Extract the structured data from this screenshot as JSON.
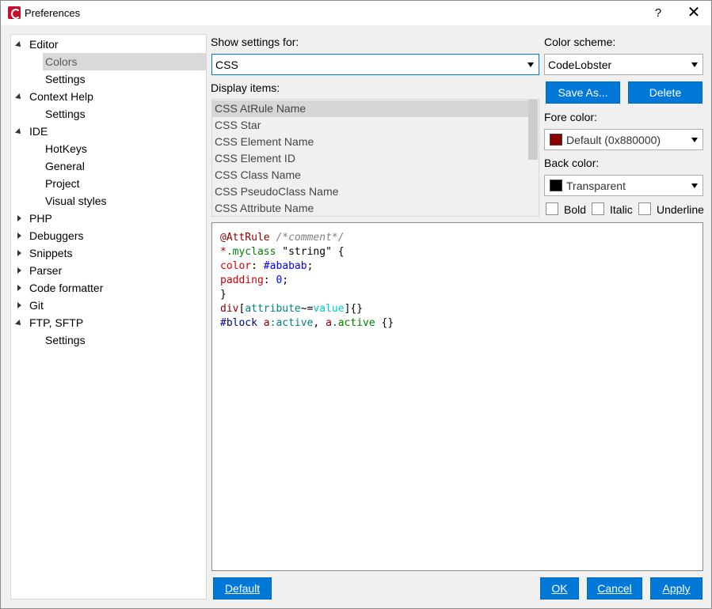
{
  "window": {
    "title": "Preferences",
    "help_label": "?",
    "close_label": "✕"
  },
  "tree": [
    {
      "label": "Editor",
      "level": 0,
      "expanded": true
    },
    {
      "label": "Colors",
      "level": 1,
      "selected": true
    },
    {
      "label": "Settings",
      "level": 1
    },
    {
      "label": "Context Help",
      "level": 0,
      "expanded": true
    },
    {
      "label": "Settings",
      "level": 1
    },
    {
      "label": "IDE",
      "level": 0,
      "expanded": true
    },
    {
      "label": "HotKeys",
      "level": 1
    },
    {
      "label": "General",
      "level": 1
    },
    {
      "label": "Project",
      "level": 1
    },
    {
      "label": "Visual styles",
      "level": 1
    },
    {
      "label": "PHP",
      "level": 0,
      "expanded": false
    },
    {
      "label": "Debuggers",
      "level": 0,
      "expanded": false
    },
    {
      "label": "Snippets",
      "level": 0,
      "expanded": false
    },
    {
      "label": "Parser",
      "level": 0,
      "expanded": false
    },
    {
      "label": "Code formatter",
      "level": 0,
      "expanded": false
    },
    {
      "label": "Git",
      "level": 0,
      "expanded": false
    },
    {
      "label": "FTP, SFTP",
      "level": 0,
      "expanded": true
    },
    {
      "label": "Settings",
      "level": 1
    }
  ],
  "settings_for": {
    "label": "Show settings for:",
    "value": "CSS"
  },
  "display_items": {
    "label": "Display items:",
    "items": [
      "CSS AtRule Name",
      "CSS Star",
      "CSS Element Name",
      "CSS Element ID",
      "CSS Class Name",
      "CSS PseudoClass Name",
      "CSS Attribute Name"
    ],
    "selected_index": 0
  },
  "color_scheme": {
    "label": "Color scheme:",
    "value": "CodeLobster",
    "save_as_label": "Save As...",
    "delete_label": "Delete"
  },
  "fore_color": {
    "label": "Fore color:",
    "value": "Default (0x880000)",
    "swatch": "#880000"
  },
  "back_color": {
    "label": "Back color:",
    "value": "Transparent",
    "swatch": "#000000"
  },
  "styles": {
    "bold": "Bold",
    "italic": "Italic",
    "underline": "Underline"
  },
  "preview": {
    "lines": [
      [
        {
          "t": "@AttRule",
          "c": "red"
        },
        {
          "t": " ",
          "c": "black"
        },
        {
          "t": "/*comment*/",
          "c": "gray"
        }
      ],
      [
        {
          "t": "*",
          "c": "red"
        },
        {
          "t": ".myclass",
          "c": "green"
        },
        {
          "t": " \"string\" {",
          "c": "black"
        }
      ],
      [
        {
          "t": "color",
          "c": "propred"
        },
        {
          "t": ": ",
          "c": "black"
        },
        {
          "t": "#ababab",
          "c": "blue"
        },
        {
          "t": ";",
          "c": "black"
        }
      ],
      [
        {
          "t": "padding",
          "c": "propred"
        },
        {
          "t": ": ",
          "c": "black"
        },
        {
          "t": "0",
          "c": "blue"
        },
        {
          "t": ";",
          "c": "black"
        }
      ],
      [
        {
          "t": "}",
          "c": "black"
        }
      ],
      [
        {
          "t": "div",
          "c": "red"
        },
        {
          "t": "[",
          "c": "black"
        },
        {
          "t": "attribute",
          "c": "teal"
        },
        {
          "t": "~=",
          "c": "black"
        },
        {
          "t": "value",
          "c": "cyan"
        },
        {
          "t": "]{}",
          "c": "black"
        }
      ],
      [
        {
          "t": "#block",
          "c": "navy"
        },
        {
          "t": " ",
          "c": "black"
        },
        {
          "t": "a",
          "c": "red"
        },
        {
          "t": ":active",
          "c": "teal"
        },
        {
          "t": ", ",
          "c": "black"
        },
        {
          "t": "a",
          "c": "red"
        },
        {
          "t": ".active",
          "c": "green"
        },
        {
          "t": " {}",
          "c": "black"
        }
      ]
    ]
  },
  "footer": {
    "default_label": "Default",
    "ok_label": "OK",
    "cancel_label": "Cancel",
    "apply_label": "Apply"
  }
}
